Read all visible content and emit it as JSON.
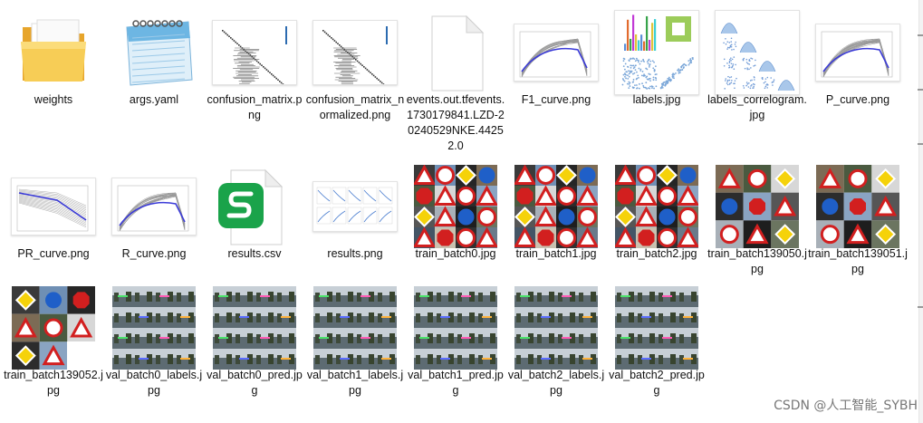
{
  "files": [
    {
      "name": "weights",
      "kind": "folder"
    },
    {
      "name": "args.yaml",
      "kind": "notepad"
    },
    {
      "name": "confusion_matrix.png",
      "kind": "confusion"
    },
    {
      "name": "confusion_matrix_normalized.png",
      "kind": "confusion"
    },
    {
      "name": "events.out.tfevents.1730179841.LZD-20240529NKE.44252.0",
      "kind": "blank"
    },
    {
      "name": "F1_curve.png",
      "kind": "curve"
    },
    {
      "name": "labels.jpg",
      "kind": "labels"
    },
    {
      "name": "labels_correlogram.jpg",
      "kind": "correlogram"
    },
    {
      "name": "P_curve.png",
      "kind": "curve"
    },
    {
      "name": "PR_curve.png",
      "kind": "pr"
    },
    {
      "name": "R_curve.png",
      "kind": "curve"
    },
    {
      "name": "results.csv",
      "kind": "csv"
    },
    {
      "name": "results.png",
      "kind": "results"
    },
    {
      "name": "train_batch0.jpg",
      "kind": "mosaic"
    },
    {
      "name": "train_batch1.jpg",
      "kind": "mosaic"
    },
    {
      "name": "train_batch2.jpg",
      "kind": "mosaic"
    },
    {
      "name": "train_batch139050.jpg",
      "kind": "mosaic2"
    },
    {
      "name": "train_batch139051.jpg",
      "kind": "mosaic2"
    },
    {
      "name": "train_batch139052.jpg",
      "kind": "mosaic3"
    },
    {
      "name": "val_batch0_labels.jpg",
      "kind": "val"
    },
    {
      "name": "val_batch0_pred.jpg",
      "kind": "val"
    },
    {
      "name": "val_batch1_labels.jpg",
      "kind": "val"
    },
    {
      "name": "val_batch1_pred.jpg",
      "kind": "val"
    },
    {
      "name": "val_batch2_labels.jpg",
      "kind": "val"
    },
    {
      "name": "val_batch2_pred.jpg",
      "kind": "val"
    }
  ],
  "watermark": "CSDN @人工智能_SYBH",
  "icons": {
    "folder": "folder-icon",
    "notepad": "notepad-icon",
    "csv": "wps-sheet-icon",
    "blank": "blank-file-icon"
  },
  "colors": {
    "folder": "#f5c542",
    "wps_green": "#1aa34a",
    "sign_red": "#d21f1f"
  }
}
